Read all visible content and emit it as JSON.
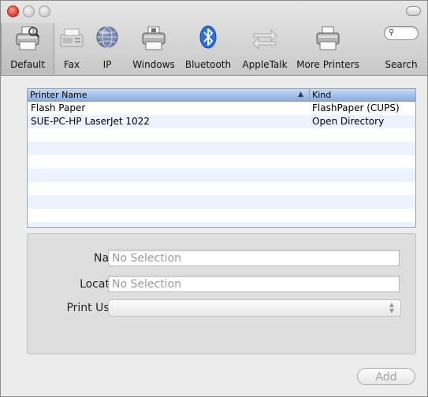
{
  "toolbar": {
    "items": [
      {
        "label": "Default",
        "icon": "printer-default-icon"
      },
      {
        "label": "Fax",
        "icon": "fax-icon"
      },
      {
        "label": "IP",
        "icon": "globe-icon"
      },
      {
        "label": "Windows",
        "icon": "windows-printer-icon"
      },
      {
        "label": "Bluetooth",
        "icon": "bluetooth-icon"
      },
      {
        "label": "AppleTalk",
        "icon": "appletalk-arrows-icon"
      },
      {
        "label": "More Printers",
        "icon": "printer-icon"
      },
      {
        "label": "Search",
        "icon": "search-icon"
      }
    ],
    "selected": "Default"
  },
  "list": {
    "columns": {
      "name": "Printer Name",
      "kind": "Kind"
    },
    "rows": [
      {
        "name": "Flash Paper",
        "kind": "FlashPaper (CUPS)"
      },
      {
        "name": "SUE-PC-HP LaserJet 1022",
        "kind": "Open Directory"
      }
    ]
  },
  "details": {
    "name_label": "Name:",
    "name_value": "No Selection",
    "location_label": "Location:",
    "location_value": "No Selection",
    "print_using_label": "Print Using:",
    "print_using_value": ""
  },
  "buttons": {
    "add": "Add"
  },
  "colors": {
    "bluetooth": "#2f6ee0",
    "header": "#a9c5ec",
    "stripe": "#edf3fe"
  }
}
